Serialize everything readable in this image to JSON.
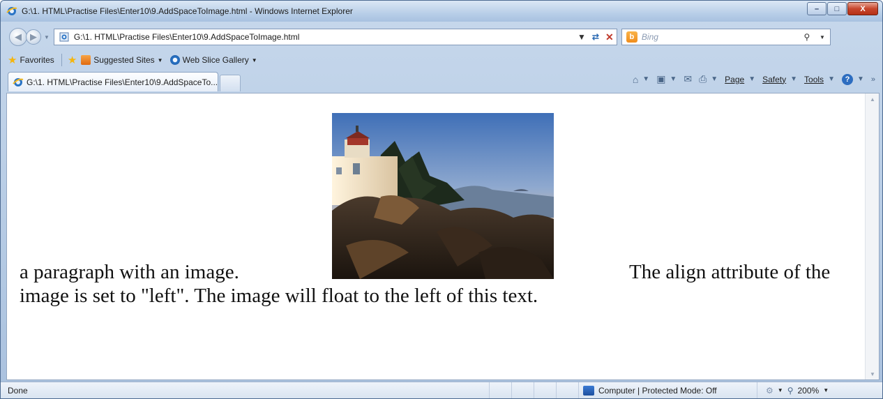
{
  "window": {
    "title": "G:\\1. HTML\\Practise Files\\Enter10\\9.AddSpaceToImage.html - Windows Internet Explorer",
    "controls": {
      "minimize": "–",
      "maximize": "□",
      "close": "X"
    }
  },
  "address_bar": {
    "url": "G:\\1. HTML\\Practise Files\\Enter10\\9.AddSpaceToImage.html",
    "search_placeholder": "Bing"
  },
  "favorites_bar": {
    "favorites_label": "Favorites",
    "items": [
      {
        "label": "Suggested Sites",
        "icon": "suggested-sites-icon"
      },
      {
        "label": "Web Slice Gallery",
        "icon": "ie-icon"
      }
    ]
  },
  "tab": {
    "label": "G:\\1. HTML\\Practise Files\\Enter10\\9.AddSpaceTo..."
  },
  "command_bar": {
    "page": "Page",
    "safety": "Safety",
    "tools": "Tools"
  },
  "page": {
    "line1_left": "a paragraph with an image.",
    "line1_right": "The align attribute of the",
    "line2": "image is set to \"left\". The image will float to the left of this text.",
    "image": "lighthouse-photo"
  },
  "status_bar": {
    "status": "Done",
    "zone": "Computer | Protected Mode: Off",
    "zoom": "200%"
  },
  "colors": {
    "frame": "#a9c1de",
    "close_button": "#c7462d",
    "link_blue": "#2c6bb3"
  }
}
